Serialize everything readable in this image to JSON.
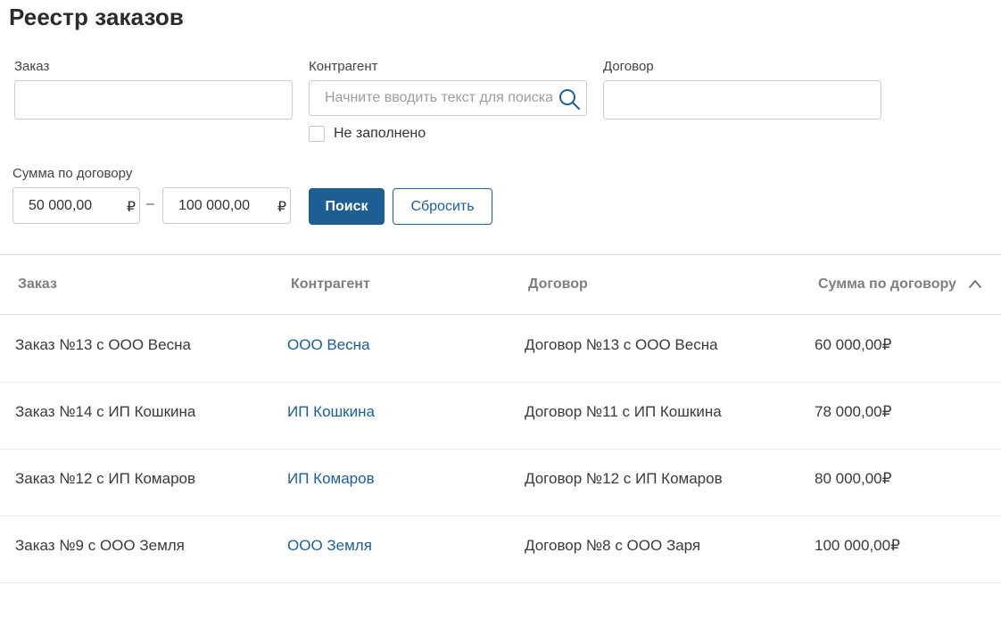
{
  "page": {
    "title": "Реестр заказов"
  },
  "filters": {
    "order": {
      "label": "Заказ",
      "value": ""
    },
    "counterparty": {
      "label": "Контрагент",
      "value": "",
      "placeholder": "Начните вводить текст для поиска",
      "empty_checkbox_label": "Не заполнено",
      "empty_checked": false
    },
    "contract": {
      "label": "Договор",
      "value": ""
    },
    "amount": {
      "label": "Сумма по договору",
      "from": "50 000,00",
      "to": "100 000,00",
      "currency": "₽",
      "separator": "–"
    },
    "search_button": "Поиск",
    "reset_button": "Сбросить"
  },
  "table": {
    "columns": [
      "Заказ",
      "Контрагент",
      "Договор",
      "Сумма по договору"
    ],
    "sort": {
      "column": "Сумма по договору",
      "direction": "ascending"
    },
    "rows": [
      {
        "order": "Заказ №13 с ООО Весна",
        "counterparty": "ООО Весна",
        "contract": "Договор №13 с ООО Весна",
        "amount": "60 000,00₽"
      },
      {
        "order": "Заказ №14 с ИП Кошкина",
        "counterparty": "ИП Кошкина",
        "contract": "Договор №11 с ИП Кошкина",
        "amount": "78 000,00₽"
      },
      {
        "order": "Заказ №12 с ИП Комаров",
        "counterparty": "ИП Комаров",
        "contract": "Договор №12 с ИП Комаров",
        "amount": "80 000,00₽"
      },
      {
        "order": "Заказ №9 с ООО Земля",
        "counterparty": "ООО Земля",
        "contract": "Договор №8 с ООО Заря",
        "amount": "100 000,00₽"
      }
    ]
  },
  "colors": {
    "accent": "#1d5f93",
    "header_text": "#7f7f7f",
    "border": "#c9ccd1"
  }
}
